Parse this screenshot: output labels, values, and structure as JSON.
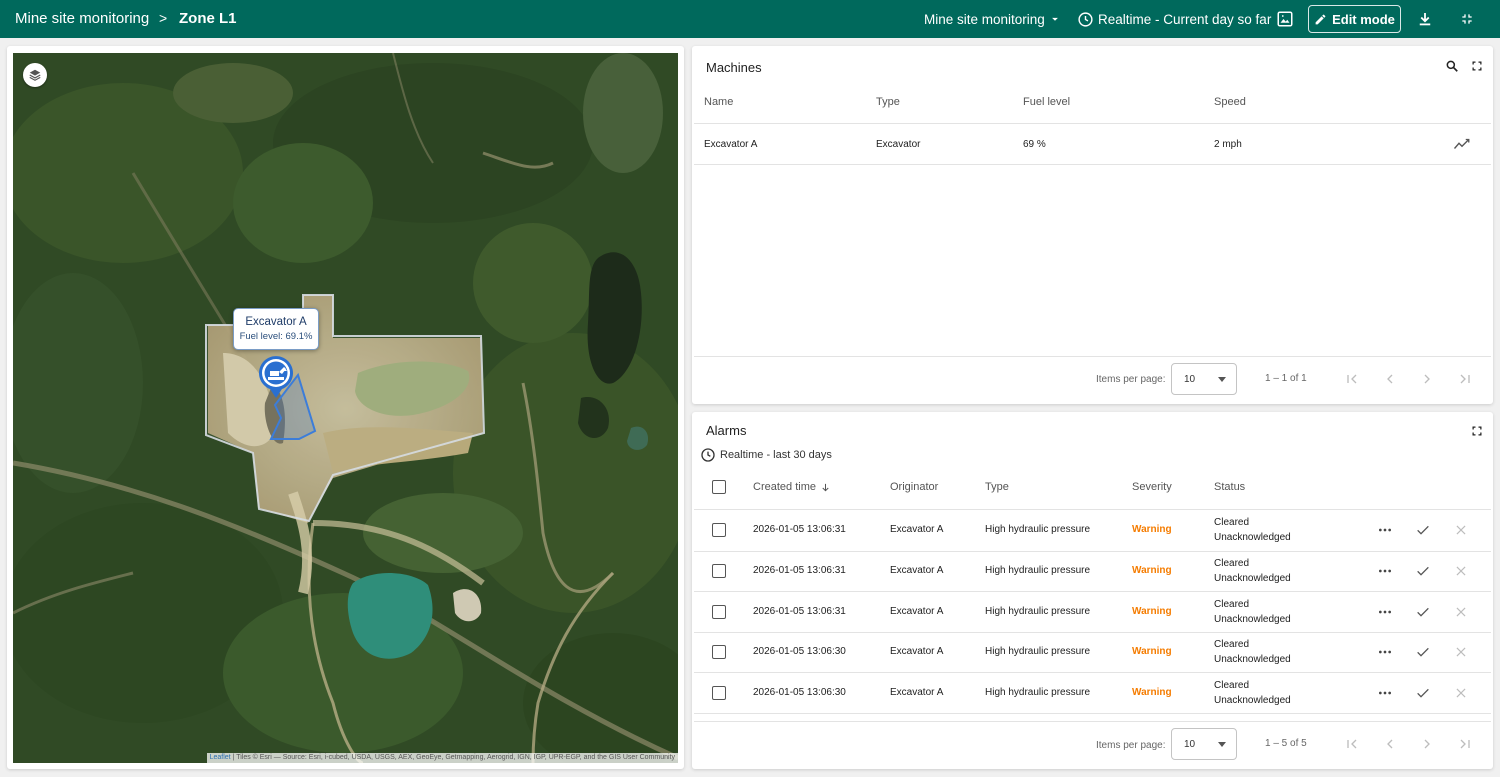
{
  "header": {
    "breadcrumb_root": "Mine site monitoring",
    "breadcrumb_separator": ">",
    "breadcrumb_current": "Zone L1",
    "dashboard_selector": "Mine site monitoring",
    "timewindow": "Realtime - Current day so far",
    "edit_label": "Edit mode",
    "accent_color": "#00695c"
  },
  "map": {
    "marker_name": "Excavator A",
    "marker_fuel": "Fuel level: 69.1%",
    "attribution_leaflet": "Leaflet",
    "attribution_text": " | Tiles © Esri — Source: Esri, i-cubed, USDA, USGS, AEX, GeoEye, Getmapping, Aerogrid, IGN, IGP, UPR-EGP, and the GIS User Community"
  },
  "machines": {
    "title": "Machines",
    "columns": [
      "Name",
      "Type",
      "Fuel level",
      "Speed"
    ],
    "rows": [
      {
        "name": "Excavator A",
        "type": "Excavator",
        "fuel": "69 %",
        "speed": "2 mph"
      }
    ],
    "pager": {
      "items_per_page_label": "Items per page:",
      "page_size": "10",
      "range": "1 – 1 of 1"
    }
  },
  "alarms": {
    "title": "Alarms",
    "timewindow": "Realtime - last 30 days",
    "columns": [
      "Created time",
      "Originator",
      "Type",
      "Severity",
      "Status"
    ],
    "rows": [
      {
        "created": "2026-01-05 13:06:31",
        "originator": "Excavator A",
        "type": "High hydraulic pressure",
        "severity": "Warning",
        "status1": "Cleared",
        "status2": "Unacknowledged"
      },
      {
        "created": "2026-01-05 13:06:31",
        "originator": "Excavator A",
        "type": "High hydraulic pressure",
        "severity": "Warning",
        "status1": "Cleared",
        "status2": "Unacknowledged"
      },
      {
        "created": "2026-01-05 13:06:31",
        "originator": "Excavator A",
        "type": "High hydraulic pressure",
        "severity": "Warning",
        "status1": "Cleared",
        "status2": "Unacknowledged"
      },
      {
        "created": "2026-01-05 13:06:30",
        "originator": "Excavator A",
        "type": "High hydraulic pressure",
        "severity": "Warning",
        "status1": "Cleared",
        "status2": "Unacknowledged"
      },
      {
        "created": "2026-01-05 13:06:30",
        "originator": "Excavator A",
        "type": "High hydraulic pressure",
        "severity": "Warning",
        "status1": "Cleared",
        "status2": "Unacknowledged"
      }
    ],
    "severity_color": "#f57c00",
    "pager": {
      "items_per_page_label": "Items per page:",
      "page_size": "10",
      "range": "1 – 5 of 5"
    }
  }
}
